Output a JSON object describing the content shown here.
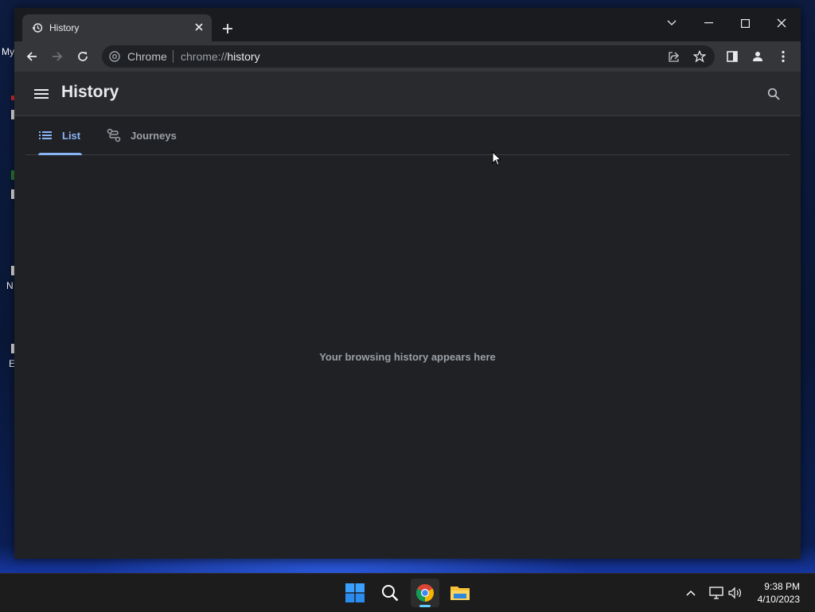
{
  "desktop": {
    "icons": [
      {
        "label": "My"
      },
      {
        "label": "N"
      },
      {
        "label": "E"
      }
    ]
  },
  "browser": {
    "tab": {
      "title": "History"
    },
    "omnibox": {
      "chip": "Chrome",
      "url_scheme": "chrome://",
      "url_host": "history"
    }
  },
  "history_page": {
    "title": "History",
    "tabs": [
      {
        "label": "List",
        "active": true
      },
      {
        "label": "Journeys",
        "active": false
      }
    ],
    "empty_message": "Your browsing history appears here"
  },
  "taskbar": {
    "time": "9:38 PM",
    "date": "4/10/2023"
  },
  "colors": {
    "accent": "#8ab4f8",
    "page_bg": "#202124",
    "header_bg": "#292a2d",
    "toolbar_bg": "#35363a",
    "taskbar_bg": "#1c1c1c"
  }
}
